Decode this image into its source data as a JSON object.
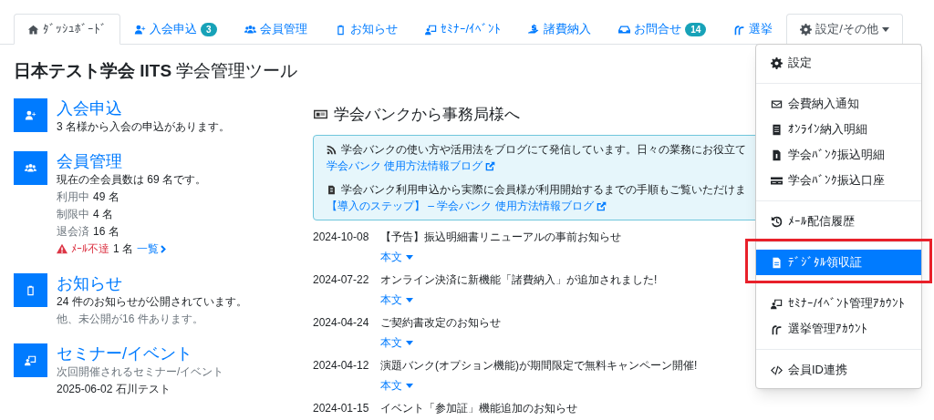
{
  "tabs": [
    {
      "label": "ﾀﾞｯｼｭﾎﾞｰﾄﾞ",
      "selected": true
    },
    {
      "label": "入会申込",
      "badge": "3",
      "selected": false
    },
    {
      "label": "会員管理",
      "selected": false
    },
    {
      "label": "お知らせ",
      "selected": false
    },
    {
      "label": "ｾﾐﾅｰ/ｲﾍﾞﾝﾄ",
      "selected": false
    },
    {
      "label": "諸費納入",
      "selected": false
    },
    {
      "label": "お問合せ",
      "badge": "14",
      "selected": false
    },
    {
      "label": "選挙",
      "selected": false
    },
    {
      "label": "設定/その他",
      "selected": false,
      "dropdown": true
    }
  ],
  "page_title": {
    "bold": "日本テスト学会 IITS",
    "rest": "学会管理ツール"
  },
  "sections": [
    {
      "title": "入会申込",
      "lines": [
        {
          "text": "3 名様から入会の申込があります。",
          "muted": false
        }
      ]
    },
    {
      "title": "会員管理",
      "lines": [
        {
          "text": "現在の全会員数は 69 名です。",
          "muted": false
        }
      ],
      "stats": [
        {
          "label": "利用中",
          "value": "49 名"
        },
        {
          "label": "制限中",
          "value": "4 名"
        },
        {
          "label": "退会済",
          "value": "16 名"
        }
      ],
      "alert": {
        "label": "ﾒｰﾙ不達",
        "value": "1 名",
        "link": "一覧"
      }
    },
    {
      "title": "お知らせ",
      "lines": [
        {
          "text": "24 件のお知らせが公開されています。",
          "muted": false
        },
        {
          "text": "他、未公開が16 件あります。",
          "muted": true
        }
      ]
    },
    {
      "title": "セミナー/イベント",
      "lines": [
        {
          "text": "次回開催されるセミナー/イベント",
          "muted": true
        },
        {
          "text": "2025-06-02 石川テスト",
          "muted": false
        }
      ]
    }
  ],
  "news": {
    "heading": "学会バンクから事務局様へ",
    "info": [
      {
        "text": "学会バンクの使い方や活用法をブログにて発信しています。日々の業務にお役立て",
        "link": "学会バンク 使用方法情報ブログ"
      },
      {
        "text": "学会バンク利用申込から実際に会員様が利用開始するまでの手順もご覧いただけま",
        "link": "【導入のステップ】 – 学会バンク 使用方法情報ブログ"
      }
    ],
    "items": [
      {
        "date": "2024-10-08",
        "title": "【予告】振込明細書リニューアルの事前お知らせ",
        "toggle": "本文"
      },
      {
        "date": "2024-07-22",
        "title": "オンライン決済に新機能「諸費納入」が追加されました!",
        "toggle": "本文"
      },
      {
        "date": "2024-04-24",
        "title": "ご契約書改定のお知らせ",
        "toggle": "本文"
      },
      {
        "date": "2024-04-12",
        "title": "演題バンク(オプション機能)が期間限定で無料キャンペーン開催!",
        "toggle": "本文"
      },
      {
        "date": "2024-01-15",
        "title": "イベント「参加証」機能追加のお知らせ"
      }
    ]
  },
  "menu": [
    {
      "kind": "item",
      "label": "設定",
      "selected": false,
      "highlighted": false
    },
    {
      "kind": "divider"
    },
    {
      "kind": "item",
      "label": "会費納入通知",
      "selected": false,
      "highlighted": false
    },
    {
      "kind": "item",
      "label": "ｵﾝﾗｲﾝ納入明細",
      "selected": false,
      "highlighted": false
    },
    {
      "kind": "item",
      "label": "学会ﾊﾞﾝｸ振込明細",
      "selected": false,
      "highlighted": false
    },
    {
      "kind": "item",
      "label": "学会ﾊﾞﾝｸ振込口座",
      "selected": false,
      "highlighted": false
    },
    {
      "kind": "divider"
    },
    {
      "kind": "item",
      "label": "ﾒｰﾙ配信履歴",
      "selected": false,
      "highlighted": false
    },
    {
      "kind": "divider"
    },
    {
      "kind": "item",
      "label": "ﾃﾞｼﾞﾀﾙ領収証",
      "selected": true,
      "highlighted": true
    },
    {
      "kind": "divider"
    },
    {
      "kind": "item",
      "label": "ｾﾐﾅｰ/ｲﾍﾞﾝﾄ管理ｱｶｳﾝﾄ",
      "selected": false,
      "highlighted": false
    },
    {
      "kind": "item",
      "label": "選挙管理ｱｶｳﾝﾄ",
      "selected": false,
      "highlighted": false
    },
    {
      "kind": "divider"
    },
    {
      "kind": "item",
      "label": "会員ID連携",
      "selected": false,
      "highlighted": false
    }
  ]
}
